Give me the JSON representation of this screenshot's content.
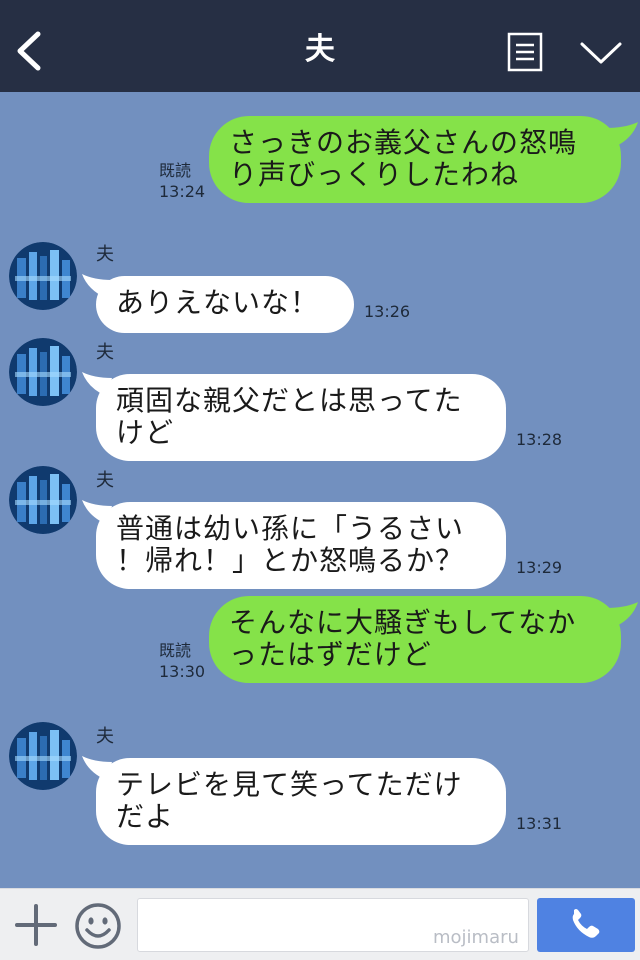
{
  "header": {
    "title": "夫"
  },
  "messages": [
    {
      "direction": "out",
      "lines": [
        "さっきのお義父さんの怒鳴",
        "り声びっくりしたわね"
      ],
      "read_label": "既読",
      "time": "13:24"
    },
    {
      "direction": "in",
      "sender": "夫",
      "lines": [
        "ありえないな！"
      ],
      "time": "13:26"
    },
    {
      "direction": "in",
      "sender": "夫",
      "lines": [
        "頑固な親父だとは思ってた",
        "けど"
      ],
      "time": "13:28"
    },
    {
      "direction": "in",
      "sender": "夫",
      "lines": [
        "普通は幼い孫に「うるさい",
        "！帰れ！」とか怒鳴るか？"
      ],
      "time": "13:29"
    },
    {
      "direction": "out",
      "lines": [
        "そんなに大騒ぎもしてなか",
        "ったはずだけど"
      ],
      "read_label": "既読",
      "time": "13:30"
    },
    {
      "direction": "in",
      "sender": "夫",
      "lines": [
        "テレビを見て笑ってただけ",
        "だよ"
      ],
      "time": "13:31"
    }
  ],
  "input": {
    "value": "",
    "placeholder": ""
  },
  "watermark": "mojimaru",
  "icons": {
    "back": "chevron-left-icon",
    "menu": "menu-list-icon",
    "collapse": "chevron-down-icon",
    "plus": "plus-icon",
    "emoji": "smiley-icon",
    "call": "phone-icon"
  },
  "colors": {
    "header_bg": "#262f44",
    "chat_bg": "#7290bf",
    "outgoing_bubble": "#85e249",
    "incoming_bubble": "#ffffff",
    "call_button": "#4f82e2"
  }
}
